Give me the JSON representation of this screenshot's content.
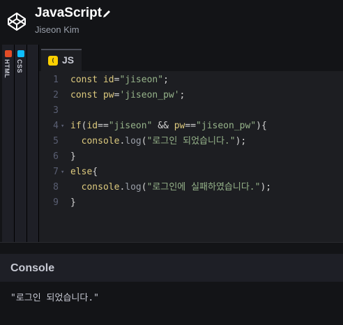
{
  "header": {
    "title": "JavaScript",
    "author": "Jiseon Kim"
  },
  "sidebar_tabs": [
    {
      "label": "HTML",
      "color": "#e34c26"
    },
    {
      "label": "CSS",
      "color": "#0ebeff"
    }
  ],
  "editor": {
    "tab_label": "JS",
    "tab_badge": "( )",
    "badge_color": "#fcd000",
    "lines": [
      {
        "n": "1",
        "code": [
          [
            "k",
            "const "
          ],
          [
            "k",
            "id"
          ],
          [
            "p",
            "="
          ],
          [
            "s",
            "\"jiseon\""
          ],
          [
            "p",
            ";"
          ]
        ]
      },
      {
        "n": "2",
        "code": [
          [
            "k",
            "const "
          ],
          [
            "k",
            "pw"
          ],
          [
            "p",
            "="
          ],
          [
            "s",
            "'jiseon_pw'"
          ],
          [
            "p",
            ";"
          ]
        ]
      },
      {
        "n": "3",
        "code": []
      },
      {
        "n": "4",
        "fold": true,
        "code": [
          [
            "k",
            "if"
          ],
          [
            "p",
            "("
          ],
          [
            "k",
            "id"
          ],
          [
            "p",
            "=="
          ],
          [
            "s",
            "\"jiseon\""
          ],
          [
            "p",
            " && "
          ],
          [
            "k",
            "pw"
          ],
          [
            "p",
            "=="
          ],
          [
            "s",
            "\"jiseon_pw\""
          ],
          [
            "p",
            "){"
          ]
        ]
      },
      {
        "n": "5",
        "code": [
          [
            "p",
            "  "
          ],
          [
            "k",
            "console"
          ],
          [
            "p",
            "."
          ],
          [
            "f",
            "log"
          ],
          [
            "p",
            "("
          ],
          [
            "s",
            "\"로그인 되었습니다.\""
          ],
          [
            "p",
            ");"
          ]
        ]
      },
      {
        "n": "6",
        "code": [
          [
            "p",
            "}"
          ]
        ]
      },
      {
        "n": "7",
        "fold": true,
        "code": [
          [
            "k",
            "else"
          ],
          [
            "p",
            "{"
          ]
        ]
      },
      {
        "n": "8",
        "code": [
          [
            "p",
            "  "
          ],
          [
            "k",
            "console"
          ],
          [
            "p",
            "."
          ],
          [
            "f",
            "log"
          ],
          [
            "p",
            "("
          ],
          [
            "s",
            "\"로그인에 실패하였습니다.\""
          ],
          [
            "p",
            ");"
          ]
        ]
      },
      {
        "n": "9",
        "code": [
          [
            "p",
            "}"
          ]
        ]
      }
    ]
  },
  "console": {
    "title": "Console",
    "output": "\"로그인 되었습니다.\""
  }
}
